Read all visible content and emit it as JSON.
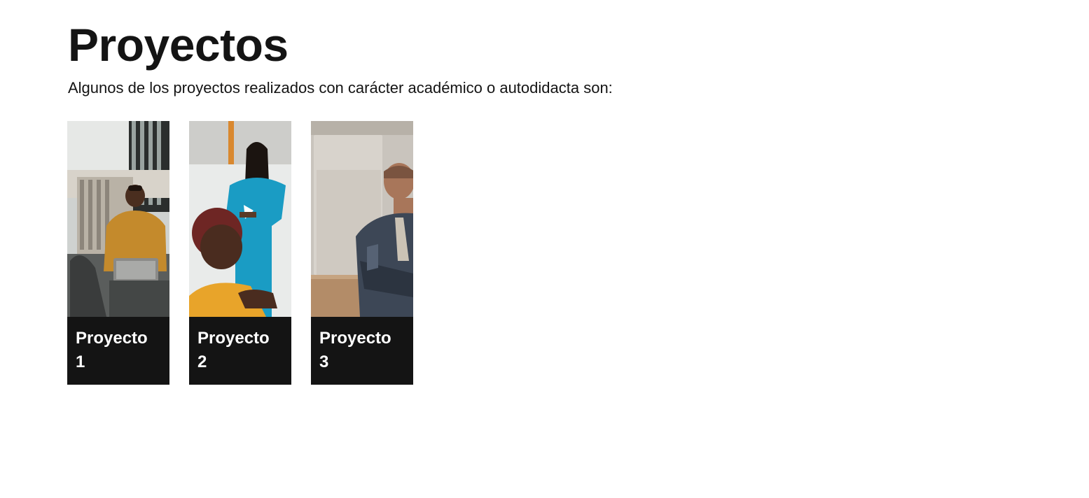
{
  "header": {
    "title": "Proyectos",
    "subtitle": "Algunos de los proyectos realizados con carácter académico o autodidacta son:"
  },
  "projects": [
    {
      "label_line1": "Proyecto",
      "label_line2": "1",
      "image": "photo-man-yellow-shirt-laptop-office"
    },
    {
      "label_line1": "Proyecto",
      "label_line2": "2",
      "image": "photo-woman-blue-jumpsuit-presenting"
    },
    {
      "label_line1": "Proyecto",
      "label_line2": "3",
      "image": "photo-man-suit-arms-crossed"
    }
  ],
  "colors": {
    "text": "#141414",
    "caption_bg": "#141414",
    "caption_text": "#ffffff",
    "background": "#ffffff"
  }
}
